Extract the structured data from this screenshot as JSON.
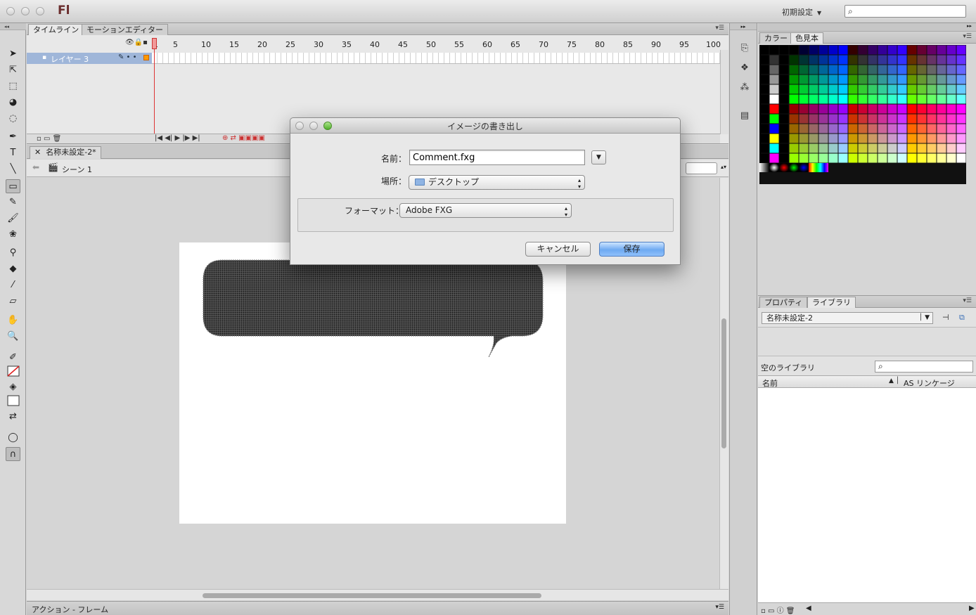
{
  "app": {
    "logo": "Fl",
    "workspace": "初期設定"
  },
  "timeline": {
    "tabs": [
      "タイムライン",
      "モーションエディター"
    ],
    "layer_name": "レイヤー 3",
    "frame_numbers": [
      "1",
      "5",
      "10",
      "15",
      "20",
      "25",
      "30",
      "35",
      "40",
      "45",
      "50",
      "55",
      "60",
      "65",
      "70",
      "75",
      "80",
      "85",
      "90",
      "95",
      "100"
    ]
  },
  "document": {
    "tab_label": "名称未設定-2*",
    "scene_label": "シーン 1"
  },
  "actions_panel": {
    "label": "アクション - フレーム"
  },
  "swatches": {
    "tabs": [
      "カラー",
      "色見本"
    ]
  },
  "library": {
    "tabs": [
      "プロパティ",
      "ライブラリ"
    ],
    "document_select": "名称未設定-2",
    "count_label": "空のライブラリ",
    "col_name": "名前",
    "col_linkage": "AS リンケージ"
  },
  "dialog": {
    "title": "イメージの書き出し",
    "name_label": "名前：",
    "name_value": "Comment.fxg",
    "location_label": "場所：",
    "location_value": "デスクトップ",
    "format_label": "フォーマット：",
    "format_value": "Adobe FXG",
    "cancel_label": "キャンセル",
    "save_label": "保存"
  }
}
